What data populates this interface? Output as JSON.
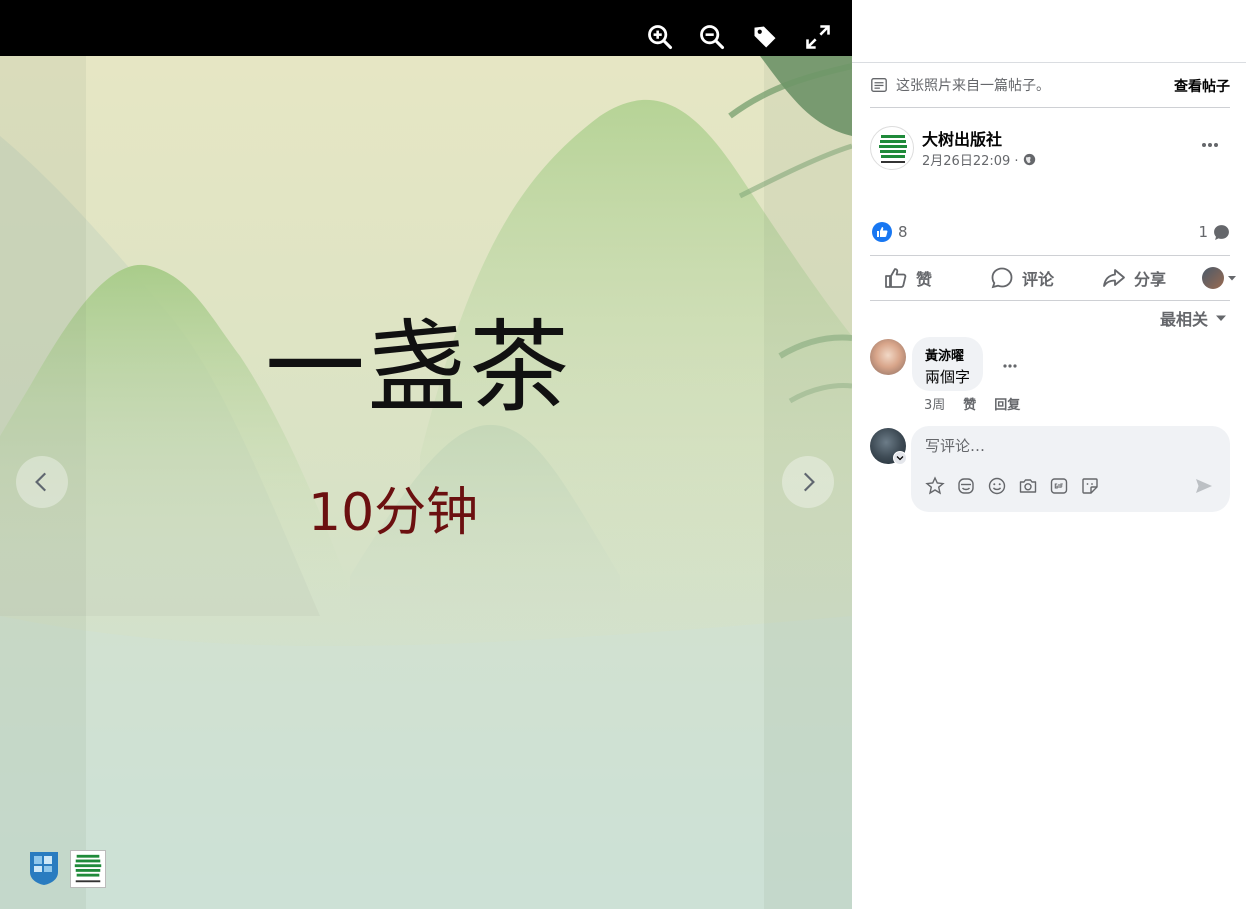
{
  "viewer": {
    "top_buttons": [
      "zoom-in-icon",
      "zoom-out-icon",
      "tag-icon",
      "fullscreen-icon"
    ],
    "photo": {
      "title": "一盏茶",
      "subtitle": "10分钟"
    },
    "nav": {
      "prev": "chevron-left-icon",
      "next": "chevron-right-icon"
    }
  },
  "panel": {
    "notice": {
      "text": "这张照片来自一篇帖子。",
      "link": "查看帖子"
    },
    "post": {
      "author": "大树出版社",
      "timestamp": "2月26日22:09 ·",
      "privacy_icon": "globe-icon"
    },
    "reactions": {
      "like_count": "8",
      "comment_count": "1"
    },
    "actions": {
      "like": "赞",
      "comment": "评论",
      "share": "分享"
    },
    "sort_label": "最相关",
    "comments": [
      {
        "name": "黃洂曜",
        "text": "兩個字",
        "time": "3周",
        "like": "赞",
        "reply": "回复"
      }
    ],
    "composer": {
      "placeholder": "写评论…"
    }
  },
  "colors": {
    "accent": "#1877f2",
    "secondary_text": "#65676b",
    "primary_text": "#050505",
    "divider": "#ced0d4",
    "bubble": "#f0f2f5",
    "subtitle_red": "#6b1010"
  }
}
